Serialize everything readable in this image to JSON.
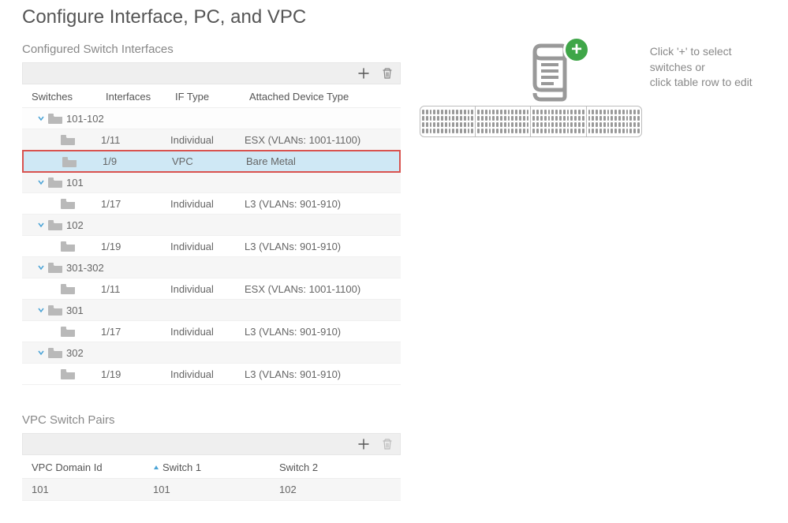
{
  "page_title": "Configure Interface, PC, and VPC",
  "section_interfaces_label": "Configured Switch Interfaces",
  "help": {
    "line1": "Click '+' to select switches or",
    "line2": "click table row to edit"
  },
  "interfaces": {
    "headers": {
      "switches": "Switches",
      "interfaces": "Interfaces",
      "iftype": "IF Type",
      "attached": "Attached Device Type"
    },
    "groups": [
      {
        "label": "101-102",
        "rows": [
          {
            "interface": "1/11",
            "iftype": "Individual",
            "attached": "ESX (VLANs: 1001-1100)",
            "selected": false
          },
          {
            "interface": "1/9",
            "iftype": "VPC",
            "attached": "Bare Metal",
            "selected": true
          }
        ]
      },
      {
        "label": "101",
        "rows": [
          {
            "interface": "1/17",
            "iftype": "Individual",
            "attached": "L3 (VLANs: 901-910)",
            "selected": false
          }
        ]
      },
      {
        "label": "102",
        "rows": [
          {
            "interface": "1/19",
            "iftype": "Individual",
            "attached": "L3 (VLANs: 901-910)",
            "selected": false
          }
        ]
      },
      {
        "label": "301-302",
        "rows": [
          {
            "interface": "1/11",
            "iftype": "Individual",
            "attached": "ESX (VLANs: 1001-1100)",
            "selected": false
          }
        ]
      },
      {
        "label": "301",
        "rows": [
          {
            "interface": "1/17",
            "iftype": "Individual",
            "attached": "L3 (VLANs: 901-910)",
            "selected": false
          }
        ]
      },
      {
        "label": "302",
        "rows": [
          {
            "interface": "1/19",
            "iftype": "Individual",
            "attached": "L3 (VLANs: 901-910)",
            "selected": false
          }
        ]
      }
    ]
  },
  "vpc": {
    "label": "VPC Switch Pairs",
    "headers": {
      "domain": "VPC Domain Id",
      "s1": "Switch 1",
      "s2": "Switch 2"
    },
    "rows": [
      {
        "domain": "101",
        "s1": "101",
        "s2": "102"
      }
    ]
  }
}
